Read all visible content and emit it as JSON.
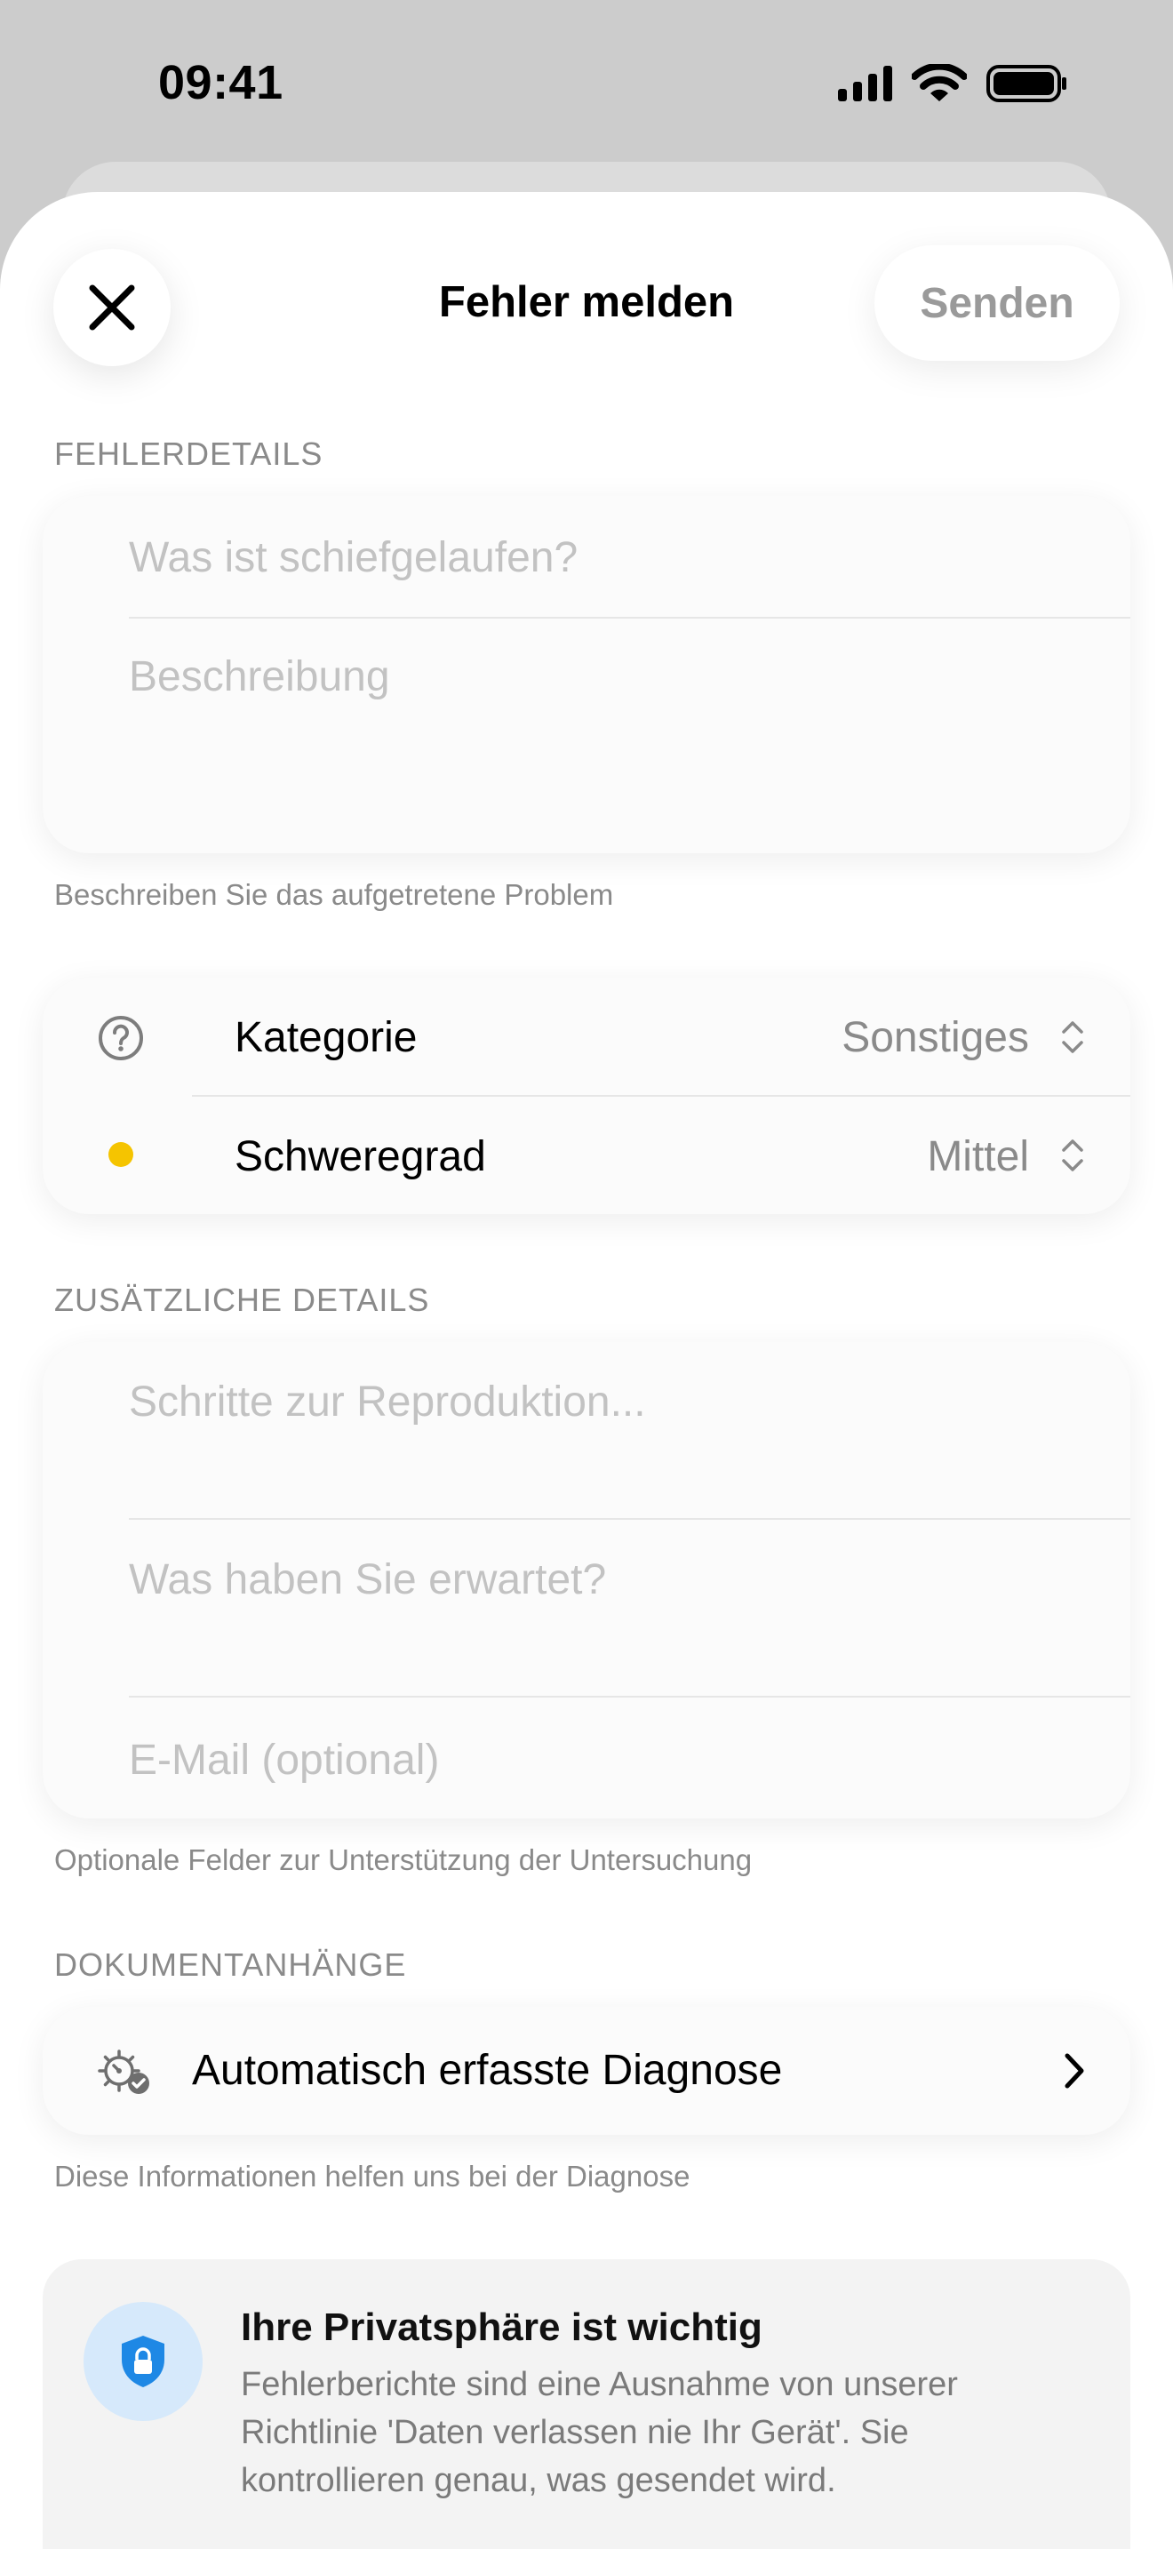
{
  "status_bar": {
    "time": "09:41"
  },
  "nav": {
    "title": "Fehler melden",
    "send_label": "Senden"
  },
  "error_details": {
    "section_label": "FEHLERDETAILS",
    "title_placeholder": "Was ist schiefgelaufen?",
    "description_placeholder": "Beschreibung",
    "footnote": "Beschreiben Sie das aufgetretene Problem"
  },
  "classification": {
    "category": {
      "label": "Kategorie",
      "value": "Sonstiges",
      "icon": "question-circle-icon"
    },
    "severity": {
      "label": "Schweregrad",
      "value": "Mittel",
      "dot_color": "#F5C400"
    }
  },
  "additional_details": {
    "section_label": "ZUSÄTZLICHE DETAILS",
    "steps_placeholder": "Schritte zur Reproduktion...",
    "expected_placeholder": "Was haben Sie erwartet?",
    "email_placeholder": "E-Mail (optional)",
    "footnote": "Optionale Felder zur Unterstützung der Untersuchung"
  },
  "attachments": {
    "section_label": "DOKUMENTANHÄNGE",
    "diagnostics_label": "Automatisch erfasste Diagnose",
    "footnote": "Diese Informationen helfen uns bei der Diagnose"
  },
  "privacy": {
    "title": "Ihre Privatsphäre ist wichtig",
    "body": "Fehlerberichte sind eine Ausnahme von unserer Richtlinie 'Daten verlassen nie Ihr Gerät'. Sie kontrollieren genau, was gesendet wird.",
    "accent_color": "#1E88E5"
  }
}
